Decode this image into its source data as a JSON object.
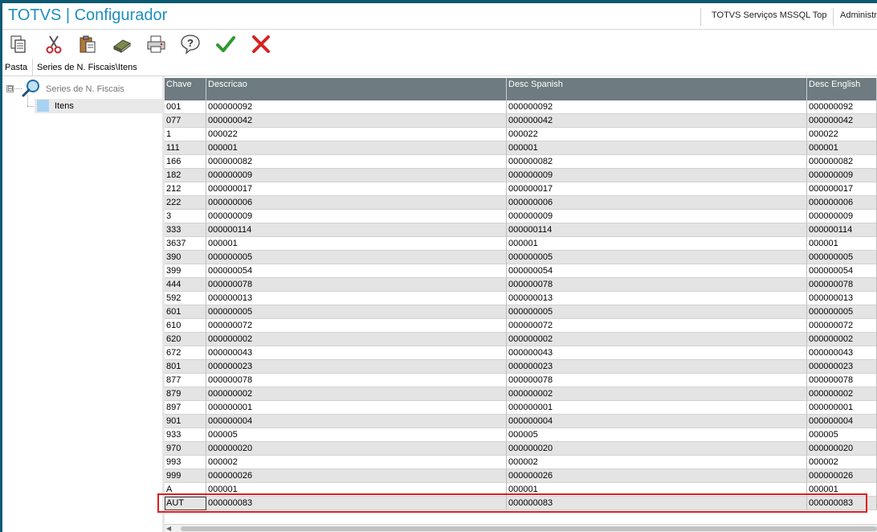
{
  "window": {
    "title": "TOTVS | Configurador",
    "server": "TOTVS Serviços MSSQL Top",
    "user": "Administr"
  },
  "toolbar": {
    "buttons": [
      {
        "icon": "copy-icon"
      },
      {
        "icon": "cut-icon"
      },
      {
        "icon": "paste-icon"
      },
      {
        "icon": "eraser-icon"
      },
      {
        "icon": "print-icon"
      },
      {
        "icon": "help-icon"
      },
      {
        "icon": "confirm-check-icon"
      },
      {
        "icon": "cancel-x-icon"
      }
    ]
  },
  "pathbar": {
    "folder_label": "Pasta",
    "path": "Series de N. Fiscais\\Itens"
  },
  "tree": {
    "root_label": "Series de N. Fiscais",
    "expander": "⊟",
    "child_label": "Itens"
  },
  "grid": {
    "columns": [
      "Chave",
      "Descricao",
      "Desc Spanish",
      "Desc English"
    ],
    "rows": [
      [
        "001",
        "000000092",
        "000000092",
        "000000092"
      ],
      [
        "077",
        "000000042",
        "000000042",
        "000000042"
      ],
      [
        "1",
        "000022",
        "000022",
        "000022"
      ],
      [
        "111",
        "000001",
        "000001",
        "000001"
      ],
      [
        "166",
        "000000082",
        "000000082",
        "000000082"
      ],
      [
        "182",
        "000000009",
        "000000009",
        "000000009"
      ],
      [
        "212",
        "000000017",
        "000000017",
        "000000017"
      ],
      [
        "222",
        "000000006",
        "000000006",
        "000000006"
      ],
      [
        "3",
        "000000009",
        "000000009",
        "000000009"
      ],
      [
        "333",
        "000000114",
        "000000114",
        "000000114"
      ],
      [
        "3637",
        "000001",
        "000001",
        "000001"
      ],
      [
        "390",
        "000000005",
        "000000005",
        "000000005"
      ],
      [
        "399",
        "000000054",
        "000000054",
        "000000054"
      ],
      [
        "444",
        "000000078",
        "000000078",
        "000000078"
      ],
      [
        "592",
        "000000013",
        "000000013",
        "000000013"
      ],
      [
        "601",
        "000000005",
        "000000005",
        "000000005"
      ],
      [
        "610",
        "000000072",
        "000000072",
        "000000072"
      ],
      [
        "620",
        "000000002",
        "000000002",
        "000000002"
      ],
      [
        "672",
        "000000043",
        "000000043",
        "000000043"
      ],
      [
        "801",
        "000000023",
        "000000023",
        "000000023"
      ],
      [
        "877",
        "000000078",
        "000000078",
        "000000078"
      ],
      [
        "879",
        "000000002",
        "000000002",
        "000000002"
      ],
      [
        "897",
        "000000001",
        "000000001",
        "000000001"
      ],
      [
        "901",
        "000000004",
        "000000004",
        "000000004"
      ],
      [
        "933",
        "000005",
        "000005",
        "000005"
      ],
      [
        "970",
        "000000020",
        "000000020",
        "000000020"
      ],
      [
        "993",
        "000002",
        "000002",
        "000002"
      ],
      [
        "999",
        "000000026",
        "000000026",
        "000000026"
      ],
      [
        "A",
        "000001",
        "000001",
        "000001"
      ],
      [
        "AUT",
        "000000083",
        "000000083",
        "000000083"
      ]
    ],
    "selected_row": 29
  },
  "scrollbar": {
    "left_arrow": "◀"
  },
  "colors": {
    "title_text": "#1f8fbf",
    "header_bg": "#6e7b80",
    "highlight_border": "#e01c1c",
    "frame": "#0b5a73"
  }
}
